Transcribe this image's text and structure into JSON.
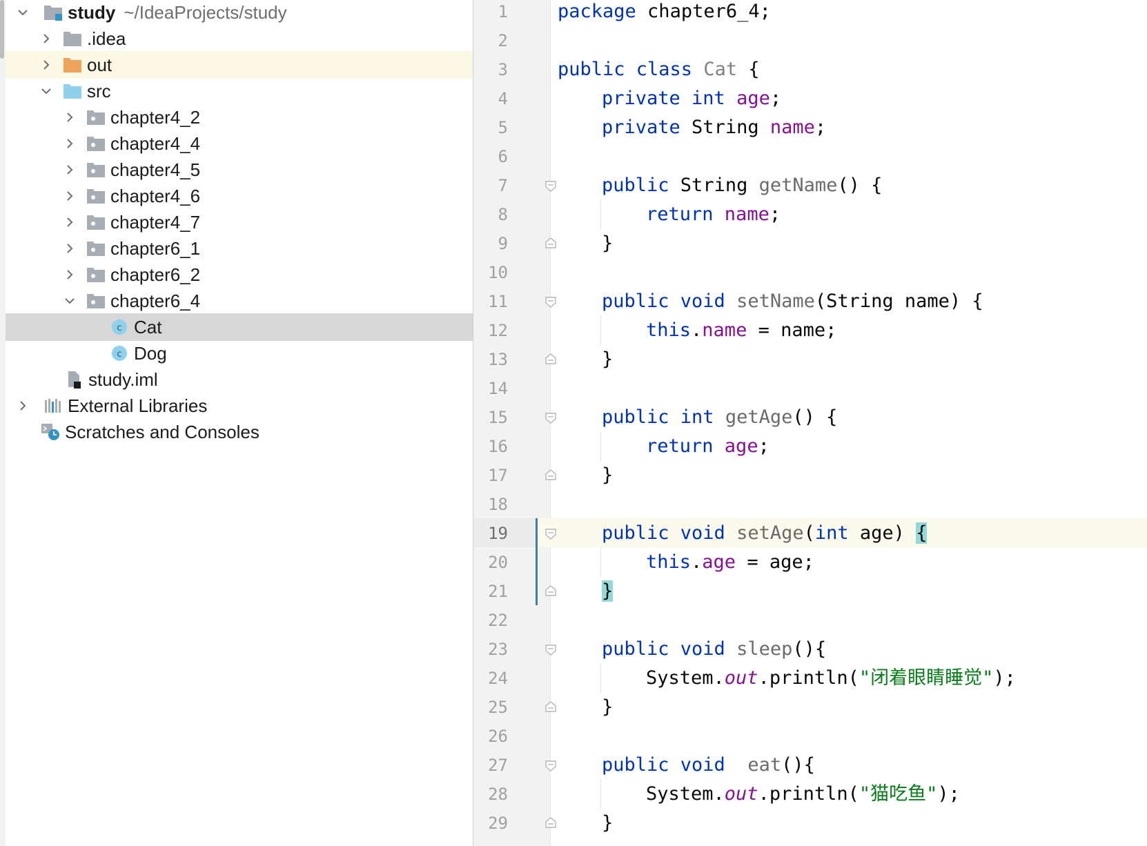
{
  "project_tree": {
    "root": {
      "name": "study",
      "path": "~/IdeaProjects/study"
    },
    "items": [
      {
        "label": ".idea"
      },
      {
        "label": "out"
      },
      {
        "label": "src"
      },
      {
        "label": "chapter4_2"
      },
      {
        "label": "chapter4_4"
      },
      {
        "label": "chapter4_5"
      },
      {
        "label": "chapter4_6"
      },
      {
        "label": "chapter4_7"
      },
      {
        "label": "chapter6_1"
      },
      {
        "label": "chapter6_2"
      },
      {
        "label": "chapter6_4"
      },
      {
        "label": "Cat"
      },
      {
        "label": "Dog"
      },
      {
        "label": "study.iml"
      },
      {
        "label": "External Libraries"
      },
      {
        "label": "Scratches and Consoles"
      }
    ]
  },
  "editor": {
    "current_line": 19,
    "line_numbers": [
      "1",
      "2",
      "3",
      "4",
      "5",
      "6",
      "7",
      "8",
      "9",
      "10",
      "11",
      "12",
      "13",
      "14",
      "15",
      "16",
      "17",
      "18",
      "19",
      "20",
      "21",
      "22",
      "23",
      "24",
      "25",
      "26",
      "27",
      "28",
      "29"
    ],
    "tokens": {
      "l1_kw": "package",
      "l1_rest": " chapter6_4;",
      "l3_kw": "public class",
      "l3_name": " Cat",
      "l3_rest": " {",
      "l4_kw": "private int",
      "l4_f": " age",
      "l4_end": ";",
      "l5_kw": "private",
      "l5_t": " String",
      "l5_f": " name",
      "l5_end": ";",
      "l7_kw": "public",
      "l7_t": " String",
      "l7_fn": " getName",
      "l7_end": "() {",
      "l8_kw": "return",
      "l8_f": " name",
      "l8_end": ";",
      "close": "}",
      "l11_kw": "public void",
      "l11_fn": " setName",
      "l11_rest": "(String name) {",
      "l12_kw": "this",
      "l12_dot": ".",
      "l12_f": "name",
      "l12_rest": " = name;",
      "l15_kw": "public int",
      "l15_fn": " getAge",
      "l15_end": "() {",
      "l16_kw": "return",
      "l16_f": " age",
      "l16_end": ";",
      "l19_kw": "public void",
      "l19_fn": " setAge",
      "l19_p1": "(",
      "l19_kw2": "int",
      "l19_p2": " age) ",
      "l19_brace": "{",
      "l20_kw": "this",
      "l20_dot": ".",
      "l20_f": "age",
      "l20_rest": " = age;",
      "l21_brace": "}",
      "l23_kw": "public void",
      "l23_fn": " sleep",
      "l23_end": "(){",
      "l24_a": "System.",
      "l24_out": "out",
      "l24_b": ".println(",
      "l24_str": "\"闭着眼睛睡觉\"",
      "l24_c": ");",
      "l27_kw": "public void",
      "l27_fn": "  eat",
      "l27_end": "(){",
      "l28_a": "System.",
      "l28_out": "out",
      "l28_b": ".println(",
      "l28_str": "\"猫吃鱼\"",
      "l28_c": ");"
    }
  },
  "colors": {
    "keyword": "#0033b3",
    "field": "#871094",
    "string": "#067d17",
    "selected_row": "#d7d7d7",
    "excluded_row": "#fbf8e4",
    "brace_match": "#93d9d9"
  },
  "icons": [
    "chevron-down-icon",
    "chevron-right-icon",
    "module-folder-icon",
    "folder-icon",
    "excluded-folder-icon",
    "source-folder-icon",
    "package-icon",
    "class-icon",
    "iml-file-icon",
    "libraries-icon",
    "scratches-icon",
    "fold-icon"
  ]
}
